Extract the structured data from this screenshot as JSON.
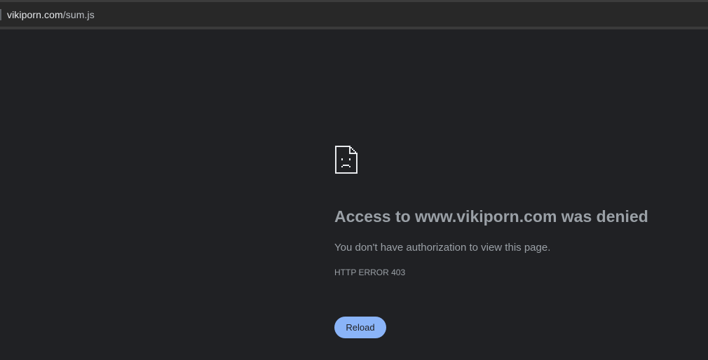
{
  "browser": {
    "address_host": "vikiporn.com",
    "address_path": "/sum.js"
  },
  "error_page": {
    "icon": "sad-document-icon",
    "title": "Access to www.vikiporn.com was denied",
    "description": "You don't have authorization to view this page.",
    "error_code": "HTTP ERROR 403",
    "reload_label": "Reload"
  },
  "colors": {
    "background": "#202124",
    "text": "#9aa0a6",
    "accent": "#8ab4f8"
  }
}
